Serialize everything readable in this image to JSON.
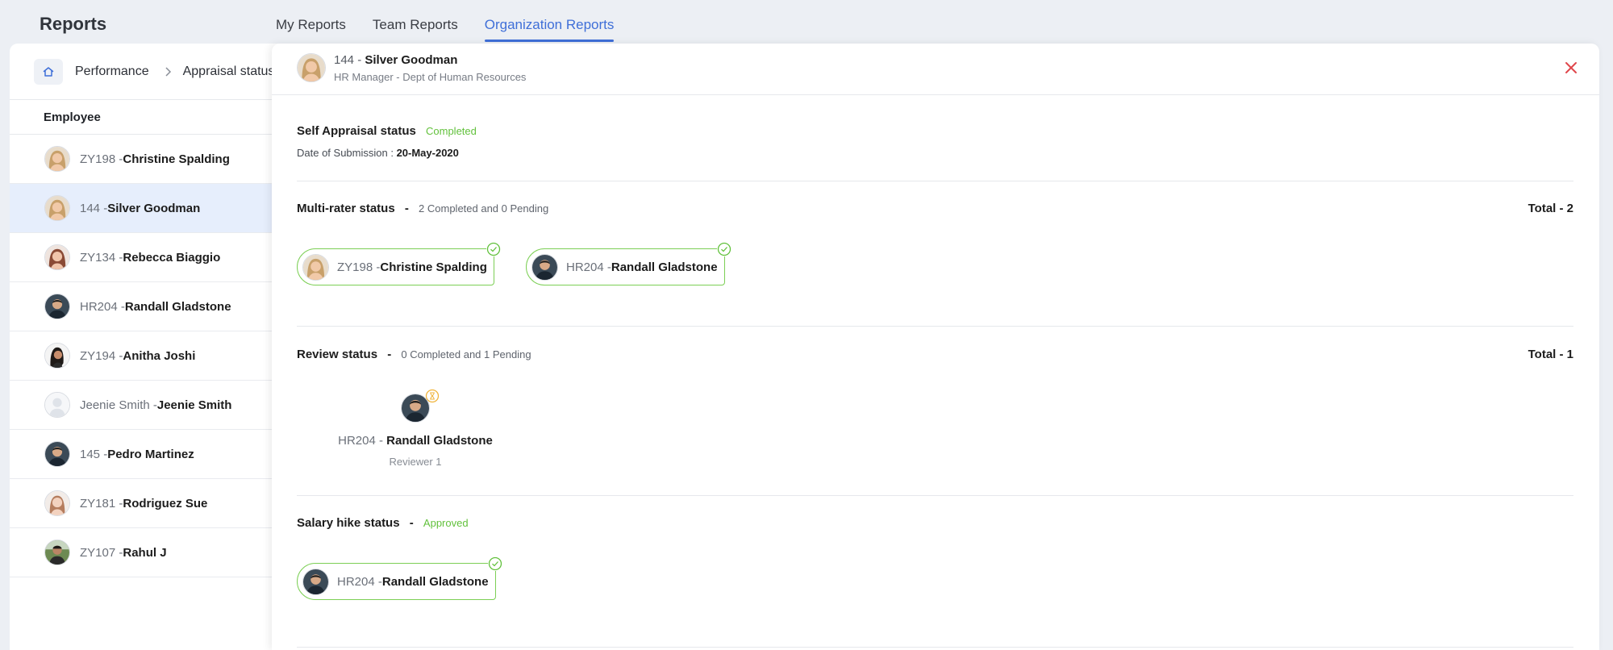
{
  "app": {
    "title": "Reports"
  },
  "tabs": [
    {
      "label": "My Reports",
      "active": false
    },
    {
      "label": "Team Reports",
      "active": false
    },
    {
      "label": "Organization Reports",
      "active": true
    }
  ],
  "breadcrumb": {
    "items": [
      "Performance",
      "Appraisal status"
    ]
  },
  "list": {
    "header": "Employee",
    "rows": [
      {
        "id": "ZY198 - ",
        "name": "Christine Spalding",
        "avatar": "female-blonde"
      },
      {
        "id": "144 - ",
        "name": "Silver Goodman",
        "avatar": "female-blonde",
        "selected": true
      },
      {
        "id": "ZY134 - ",
        "name": "Rebecca Biaggio",
        "avatar": "female-brown"
      },
      {
        "id": "HR204 - ",
        "name": "Randall Gladstone",
        "avatar": "male-dark"
      },
      {
        "id": "ZY194 - ",
        "name": "Anitha Joshi",
        "avatar": "female-dark"
      },
      {
        "id": "Jeenie Smith - ",
        "name": "Jeenie Smith",
        "avatar": "placeholder"
      },
      {
        "id": "145 - ",
        "name": "Pedro Martinez",
        "avatar": "male-dark"
      },
      {
        "id": "ZY181 - ",
        "name": "Rodriguez Sue",
        "avatar": "female-light"
      },
      {
        "id": "ZY107 - ",
        "name": "Rahul J",
        "avatar": "male-outdoor"
      }
    ]
  },
  "detail": {
    "employee": {
      "id": "144 - ",
      "name": "Silver Goodman",
      "subtitle": "HR Manager - Dept of Human Resources"
    },
    "self_appraisal": {
      "title": "Self Appraisal status",
      "status": "Completed",
      "date_label": "Date of Submission : ",
      "date_value": "20-May-2020"
    },
    "multi_rater": {
      "title": "Multi-rater status",
      "separator": "-",
      "summary": "2 Completed and 0 Pending",
      "total": "Total - 2",
      "raters": [
        {
          "id": "ZY198 - ",
          "name": "Christine Spalding",
          "avatar": "female-blonde"
        },
        {
          "id": "HR204 - ",
          "name": "Randall Gladstone",
          "avatar": "male-dark"
        }
      ]
    },
    "review": {
      "title": "Review status",
      "separator": "-",
      "summary": "0 Completed and 1 Pending",
      "total": "Total - 1",
      "reviewer": {
        "id": "HR204 - ",
        "name": "Randall Gladstone",
        "role": "Reviewer 1"
      }
    },
    "salary_hike": {
      "title": "Salary hike status",
      "separator": "-",
      "status": "Approved",
      "approver": {
        "id": "HR204 - ",
        "name": "Randall Gladstone"
      }
    }
  },
  "colors": {
    "accent": "#3f6fd8",
    "success": "#62c13c",
    "pending": "#f0b43c",
    "close": "#e0474c",
    "selected_row": "#e6eefc"
  }
}
